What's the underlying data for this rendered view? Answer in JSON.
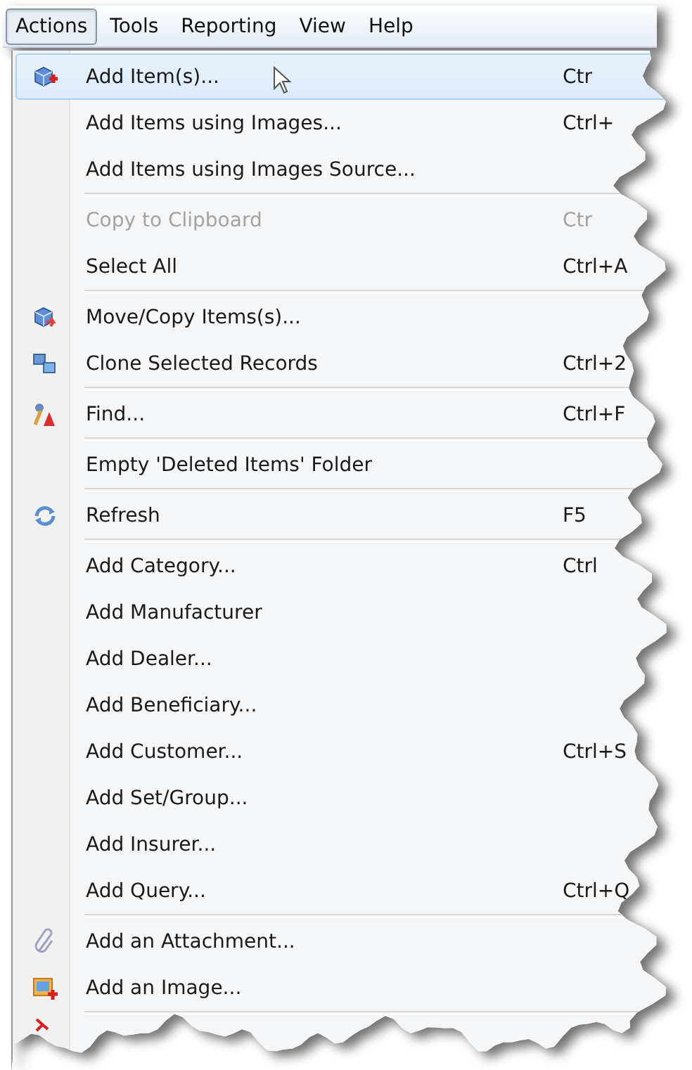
{
  "menubar": [
    {
      "label": "Actions",
      "selected": true
    },
    {
      "label": "Tools",
      "selected": false
    },
    {
      "label": "Reporting",
      "selected": false
    },
    {
      "label": "View",
      "selected": false
    },
    {
      "label": "Help",
      "selected": false
    }
  ],
  "menu": [
    {
      "kind": "item",
      "label": "Add Item(s)...",
      "shortcut": "Ctr",
      "selected": true,
      "disabled": false
    },
    {
      "kind": "item",
      "label": "Add Items using Images...",
      "shortcut": "Ctrl+",
      "selected": false,
      "disabled": false
    },
    {
      "kind": "item",
      "label": "Add Items using Images Source...",
      "selected": false,
      "disabled": false
    },
    {
      "kind": "separator"
    },
    {
      "kind": "item",
      "label": "Copy to Clipboard",
      "shortcut": "Ctr",
      "selected": false,
      "disabled": true
    },
    {
      "kind": "item",
      "label": "Select All",
      "shortcut": "Ctrl+A",
      "selected": false,
      "disabled": false
    },
    {
      "kind": "separator"
    },
    {
      "kind": "item",
      "label": "Move/Copy Items(s)...",
      "selected": false,
      "disabled": false
    },
    {
      "kind": "item",
      "label": "Clone Selected Records",
      "shortcut": "Ctrl+2",
      "selected": false,
      "disabled": false
    },
    {
      "kind": "separator"
    },
    {
      "kind": "item",
      "label": "Find...",
      "shortcut": "Ctrl+F",
      "selected": false,
      "disabled": false
    },
    {
      "kind": "separator"
    },
    {
      "kind": "item",
      "label": "Empty 'Deleted Items' Folder",
      "selected": false,
      "disabled": false
    },
    {
      "kind": "separator"
    },
    {
      "kind": "item",
      "label": "Refresh",
      "shortcut": "F5",
      "selected": false,
      "disabled": false
    },
    {
      "kind": "separator"
    },
    {
      "kind": "item",
      "label": "Add Category...",
      "shortcut": "Ctrl",
      "selected": false,
      "disabled": false
    },
    {
      "kind": "item",
      "label": "Add Manufacturer",
      "selected": false,
      "disabled": false
    },
    {
      "kind": "item",
      "label": "Add Dealer...",
      "selected": false,
      "disabled": false
    },
    {
      "kind": "item",
      "label": "Add Beneficiary...",
      "selected": false,
      "disabled": false
    },
    {
      "kind": "item",
      "label": "Add Customer...",
      "shortcut": "Ctrl+S",
      "selected": false,
      "disabled": false
    },
    {
      "kind": "item",
      "label": "Add Set/Group...",
      "selected": false,
      "disabled": false
    },
    {
      "kind": "item",
      "label": "Add Insurer...",
      "selected": false,
      "disabled": false
    },
    {
      "kind": "item",
      "label": "Add Query...",
      "shortcut": "Ctrl+Q",
      "selected": false,
      "disabled": false
    },
    {
      "kind": "separator"
    },
    {
      "kind": "item",
      "label": "Add an Attachment...",
      "selected": false,
      "disabled": false
    },
    {
      "kind": "item",
      "label": "Add an Image...",
      "selected": false,
      "disabled": false
    },
    {
      "kind": "separator"
    },
    {
      "kind": "partial"
    }
  ]
}
